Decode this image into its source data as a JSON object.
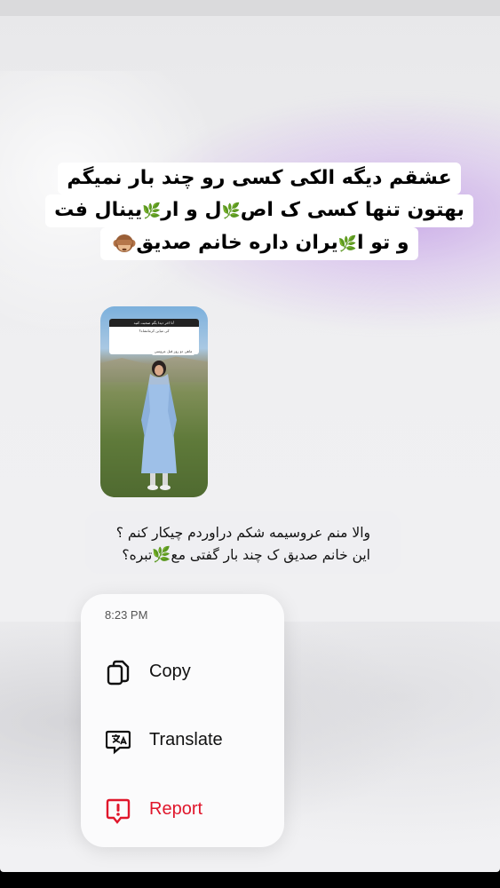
{
  "caption": {
    "line1": "عشقم دیگه الکی کسی رو چند بار نمیگم",
    "line2_part1": "بهتون تنها کسی ک اص",
    "line2_leaf1": "🌿",
    "line2_part2": "ل و ار",
    "line2_leaf2": "🌿",
    "line2_part3": "یینال فت",
    "line3_part1": "و تو ا",
    "line3_leaf": "🌿",
    "line3_part2": "یران داره خانم صدیق"
  },
  "story_preview": {
    "question_header": "تا اخر دیدا بگم صحبت کنید!",
    "question_text": "کی میاین کرمانشاه؟",
    "answer_text": "ماهی دو روز قبل عروسی"
  },
  "reply": {
    "line1": "والا منم عروسیمه شکم دراوردم چیکار کنم ؟",
    "line2_part1": "این خانم صدیق ک چند بار گفتی مع",
    "line2_leaf": "🌿",
    "line2_part2": "تبره؟"
  },
  "menu": {
    "time": "8:23 PM",
    "items": [
      {
        "label": "Copy",
        "icon": "copy-icon"
      },
      {
        "label": "Translate",
        "icon": "translate-icon"
      },
      {
        "label": "Report",
        "icon": "report-icon",
        "color": "#e0162b"
      }
    ]
  }
}
